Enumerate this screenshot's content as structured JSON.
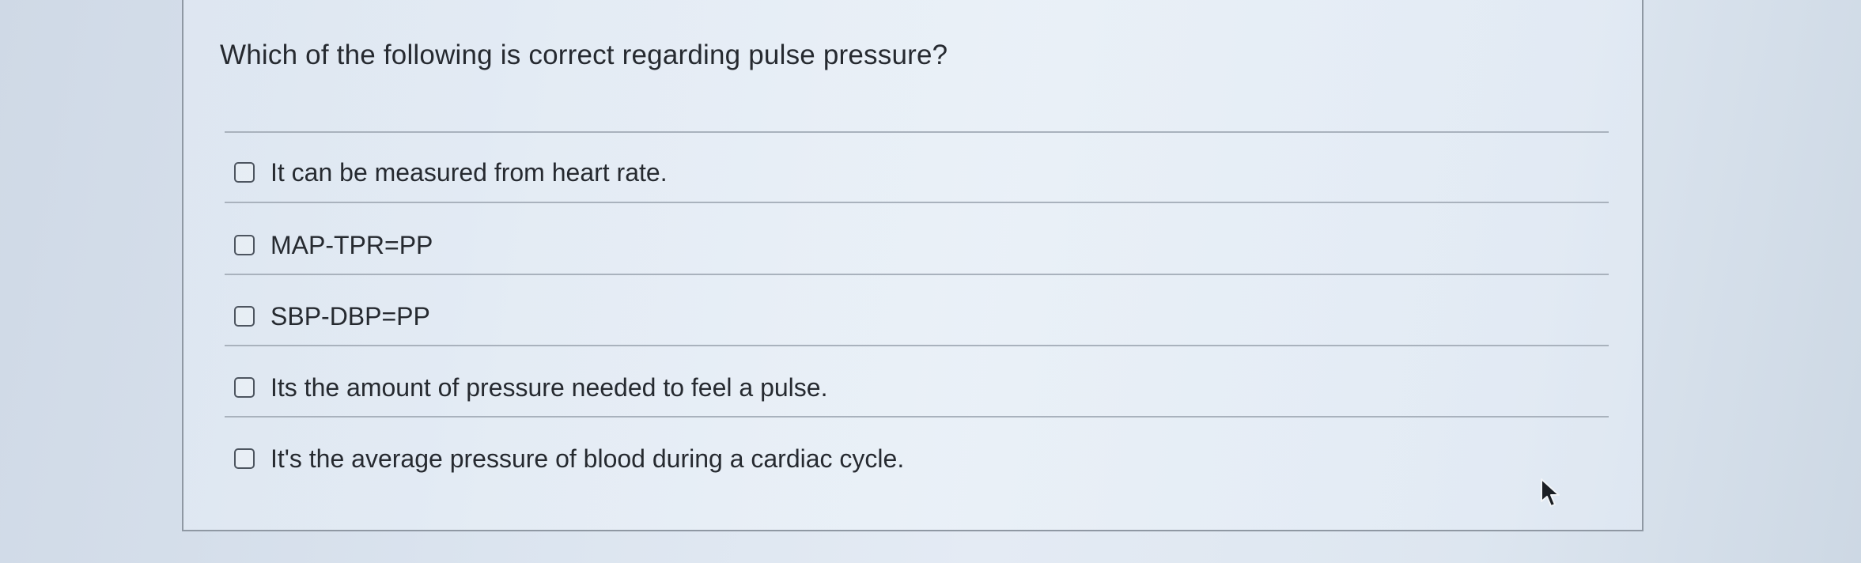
{
  "question": {
    "text": "Which of the following is correct regarding pulse pressure?"
  },
  "options": [
    {
      "label": "It can be measured from heart rate.",
      "checked": false
    },
    {
      "label": "MAP-TPR=PP",
      "checked": false
    },
    {
      "label": "SBP-DBP=PP",
      "checked": false
    },
    {
      "label": "Its the amount of pressure needed to feel a pulse.",
      "checked": false
    },
    {
      "label": "It's the average pressure of blood during a cardiac cycle.",
      "checked": false
    }
  ],
  "icons": {
    "cursor": "mouse-pointer-icon",
    "checkbox": "checkbox-icon"
  },
  "colors": {
    "text": "#262a30",
    "border": "#8f98a3",
    "divider": "#a9b2bd"
  }
}
